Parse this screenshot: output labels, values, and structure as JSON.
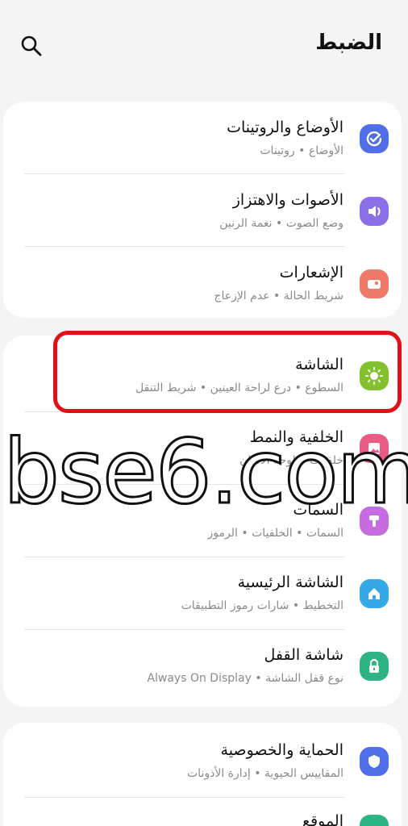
{
  "header": {
    "title": "الضبط"
  },
  "items": [
    {
      "title": "الأوضاع والروتينات",
      "subtitle": "الأوضاع • روتينات",
      "icon": "modes-check-icon",
      "color": "#4f6ee8"
    },
    {
      "title": "الأصوات والاهتزاز",
      "subtitle": "وضع الصوت • نغمة الرنين",
      "icon": "speaker-icon",
      "color": "#8b6fe8"
    },
    {
      "title": "الإشعارات",
      "subtitle": "شريط الحالة • عدم الإزعاج",
      "icon": "notification-icon",
      "color": "#f07a6a"
    },
    {
      "title": "الشاشة",
      "subtitle": "السطوع • درع لراحة العينين • شريط التنقل",
      "icon": "sun-icon",
      "color": "#82c12d"
    },
    {
      "title": "الخلفية والنمط",
      "subtitle": "خلفيات • لوحة الألوان",
      "icon": "image-icon",
      "color": "#ea5b83"
    },
    {
      "title": "السمات",
      "subtitle": "السمات • الخلفيات • الرموز",
      "icon": "theme-icon",
      "color": "#c66be0"
    },
    {
      "title": "الشاشة الرئيسية",
      "subtitle": "التخطيط • شارات رموز التطبيقات",
      "icon": "home-icon",
      "color": "#35a9e8"
    },
    {
      "title": "شاشة القفل",
      "subtitle": "نوع قفل الشاشة • Always On Display",
      "icon": "lock-icon",
      "color": "#2eb382"
    },
    {
      "title": "الحماية والخصوصية",
      "subtitle": "المقاييس الحيوية • إدارة الأذونات",
      "icon": "shield-icon",
      "color": "#4f6ee8"
    },
    {
      "title": "الموقع",
      "subtitle": "",
      "icon": "location-icon",
      "color": "#2eb382"
    }
  ],
  "watermark": "bse6.com"
}
